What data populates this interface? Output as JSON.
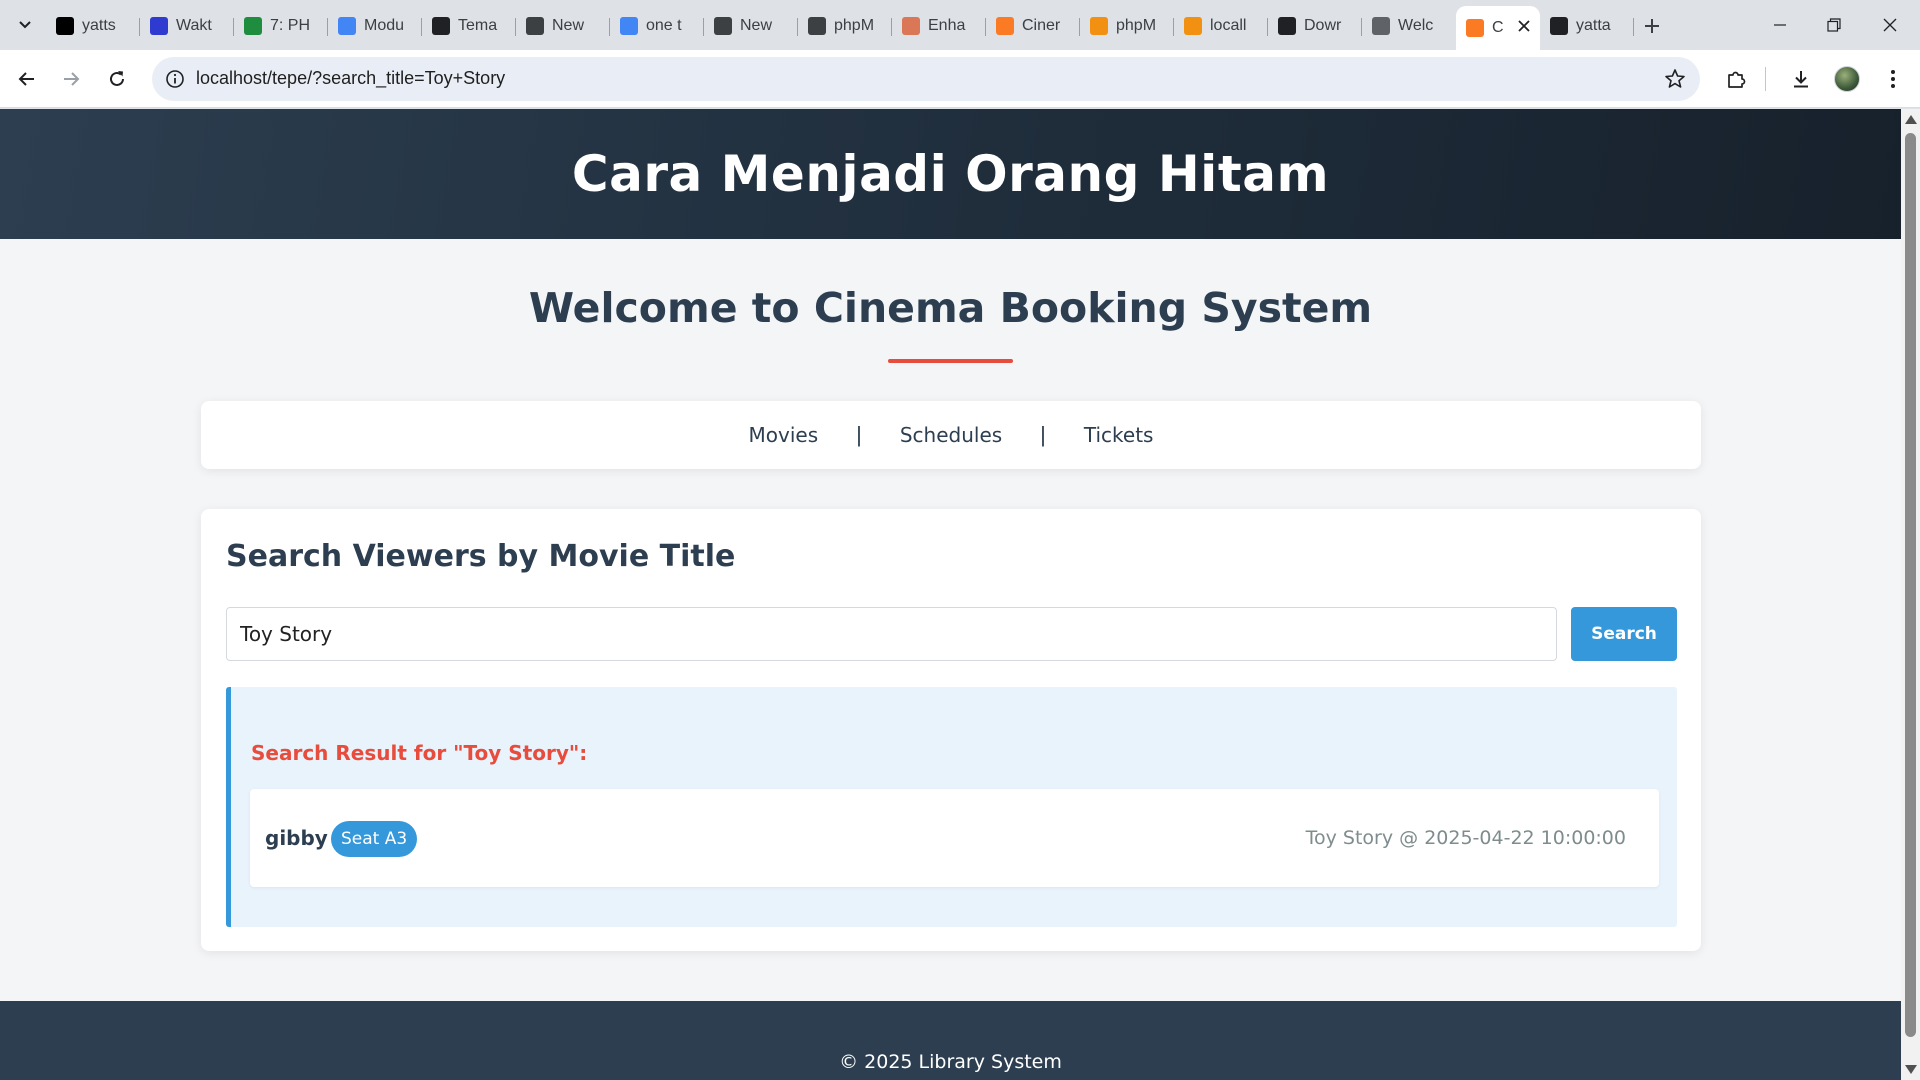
{
  "browser": {
    "tabs": [
      {
        "title": "yatts",
        "icon": "x-logo-icon",
        "color": "#000000"
      },
      {
        "title": "Wakt",
        "icon": "wakatime-icon",
        "color": "#2f3ad0"
      },
      {
        "title": "7: PH",
        "icon": "google-drive-icon",
        "color": "#1e8e3e"
      },
      {
        "title": "Modu",
        "icon": "google-docs-icon",
        "color": "#4285f4"
      },
      {
        "title": "Tema",
        "icon": "openai-icon",
        "color": "#202124"
      },
      {
        "title": "New",
        "icon": "chatgpt-icon",
        "color": "#3c4043"
      },
      {
        "title": "one t",
        "icon": "google-icon",
        "color": "#4285f4"
      },
      {
        "title": "New",
        "icon": "chatgpt-icon",
        "color": "#3c4043"
      },
      {
        "title": "phpM",
        "icon": "laptop-icon",
        "color": "#3c4043"
      },
      {
        "title": "Enha",
        "icon": "claude-icon",
        "color": "#d97757"
      },
      {
        "title": "Ciner",
        "icon": "xampp-icon",
        "color": "#fb7a24"
      },
      {
        "title": "phpM",
        "icon": "phpmyadmin-icon",
        "color": "#f29111"
      },
      {
        "title": "locall",
        "icon": "phpmyadmin-icon",
        "color": "#f29111"
      },
      {
        "title": "Dowr",
        "icon": "download-site-icon",
        "color": "#202124"
      },
      {
        "title": "Welc",
        "icon": "globe-icon",
        "color": "#5f6368"
      },
      {
        "title": "C",
        "icon": "xampp-icon",
        "color": "#fb7a24",
        "active": true
      },
      {
        "title": "yatta",
        "icon": "github-icon",
        "color": "#202124"
      }
    ],
    "url": "localhost/tepe/?search_title=Toy+Story"
  },
  "page": {
    "site_title": "Cara Menjadi Orang Hitam",
    "welcome": "Welcome to Cinema Booking System",
    "nav": {
      "movies": "Movies",
      "schedules": "Schedules",
      "tickets": "Tickets",
      "separator": "|"
    },
    "search": {
      "heading": "Search Viewers by Movie Title",
      "value": "Toy Story",
      "button": "Search"
    },
    "result": {
      "heading": "Search Result for \"Toy Story\":",
      "rows": [
        {
          "name": "gibby",
          "seat": "Seat A3",
          "showtime": "Toy Story @ 2025-04-22 10:00:00"
        }
      ]
    },
    "footer": "© 2025 Library System"
  },
  "colors": {
    "header_bg": "#2c3e50",
    "accent_red": "#e74c3c",
    "accent_blue": "#3498db",
    "result_bg": "#e8f3fc",
    "page_bg": "#f4f5f7"
  }
}
